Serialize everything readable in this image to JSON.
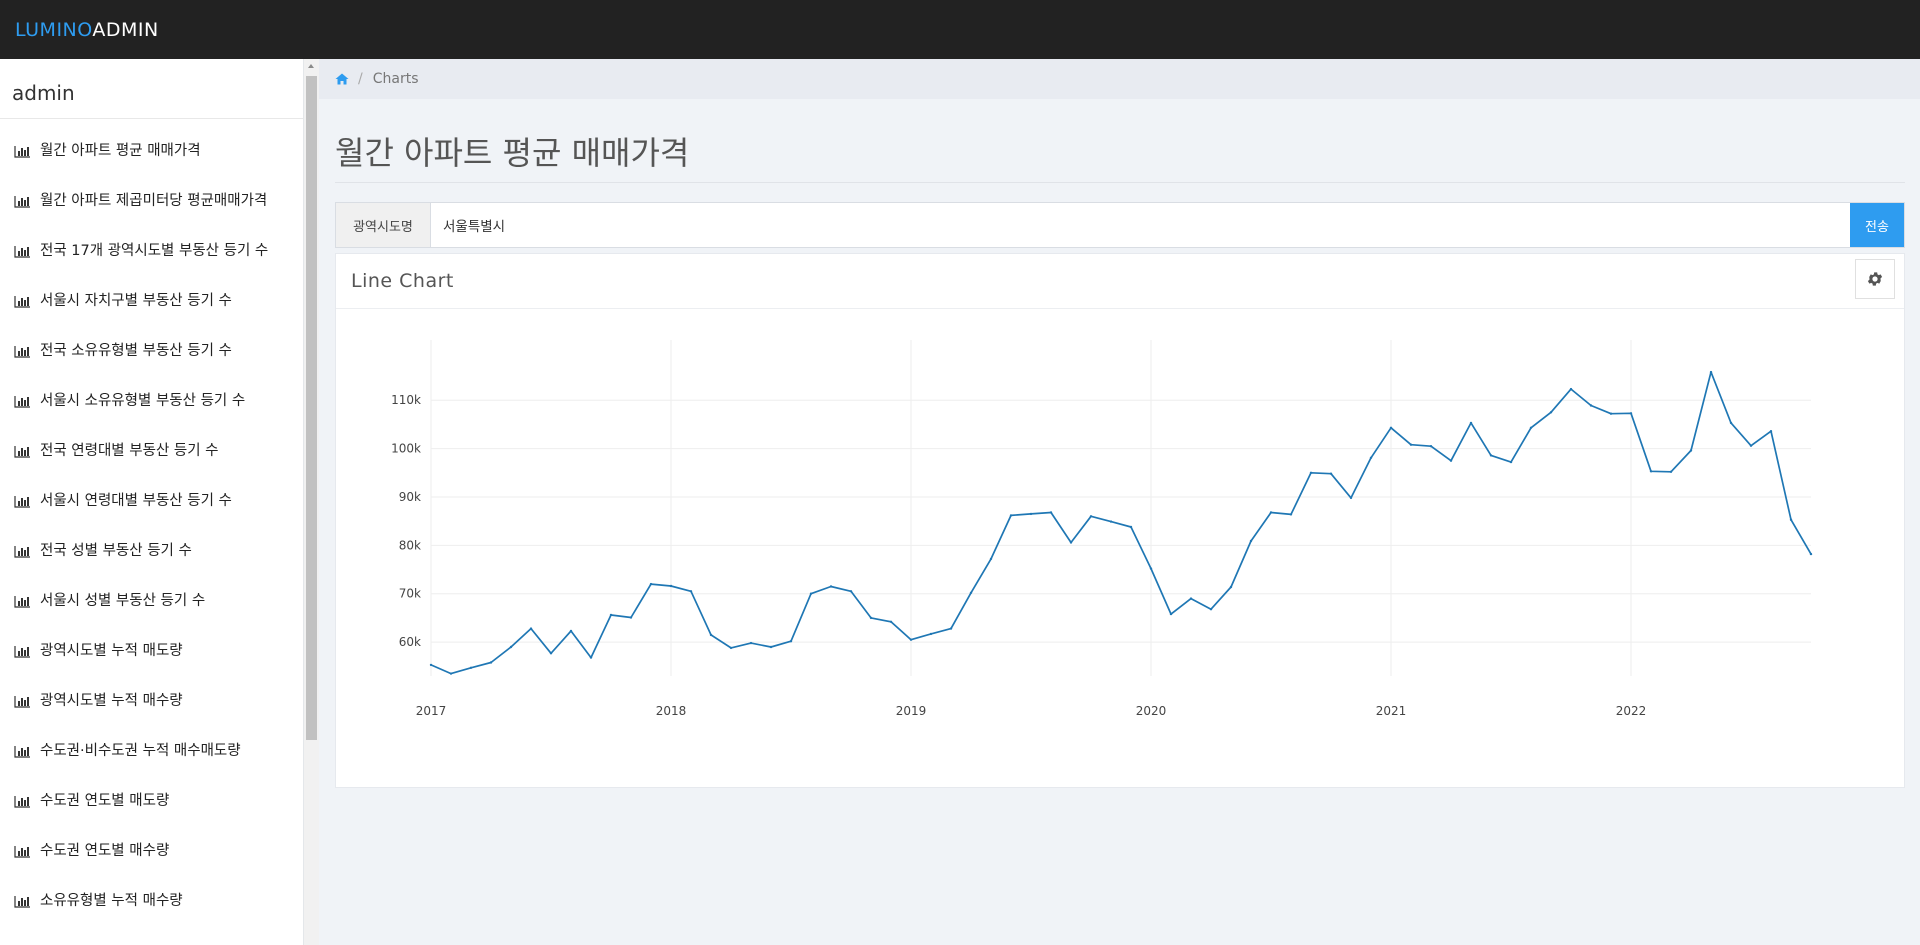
{
  "brand": {
    "part1": "LUMINO",
    "part2": "ADMIN"
  },
  "sidebar": {
    "user": "admin",
    "items": [
      {
        "label": "월간 아파트 평균 매매가격"
      },
      {
        "label": "월간 아파트 제곱미터당 평균매매가격"
      },
      {
        "label": "전국 17개 광역시도별 부동산 등기 수"
      },
      {
        "label": "서울시 자치구별 부동산 등기 수"
      },
      {
        "label": "전국 소유유형별 부동산 등기 수"
      },
      {
        "label": "서울시 소유유형별 부동산 등기 수"
      },
      {
        "label": "전국 연령대별 부동산 등기 수"
      },
      {
        "label": "서울시 연령대별 부동산 등기 수"
      },
      {
        "label": "전국 성별 부동산 등기 수"
      },
      {
        "label": "서울시 성별 부동산 등기 수"
      },
      {
        "label": "광역시도별 누적 매도량"
      },
      {
        "label": "광역시도별 누적 매수량"
      },
      {
        "label": "수도권·비수도권 누적 매수매도량"
      },
      {
        "label": "수도권 연도별 매도량"
      },
      {
        "label": "수도권 연도별 매수량"
      },
      {
        "label": "소유유형별 누적 매수량"
      }
    ]
  },
  "breadcrumb": {
    "current": "Charts",
    "separator": "/"
  },
  "page": {
    "title": "월간 아파트 평균 매매가격"
  },
  "search": {
    "label": "광역시도명",
    "value": "서울특별시",
    "button": "전송"
  },
  "panel": {
    "title": "Line Chart"
  },
  "colors": {
    "accent": "#2e9cf0",
    "line": "#1f77b4"
  },
  "chart_data": {
    "type": "line",
    "title": "",
    "xlabel": "",
    "ylabel": "",
    "xlim": [
      0,
      69
    ],
    "ylim": [
      53000,
      115000
    ],
    "x_ticks": [
      {
        "label": "2017",
        "x": 0
      },
      {
        "label": "2018",
        "x": 12
      },
      {
        "label": "2019",
        "x": 24
      },
      {
        "label": "2020",
        "x": 36
      },
      {
        "label": "2021",
        "x": 48
      },
      {
        "label": "2022",
        "x": 60
      }
    ],
    "y_ticks": [
      {
        "label": "60k",
        "y": 60000
      },
      {
        "label": "70k",
        "y": 70000
      },
      {
        "label": "80k",
        "y": 80000
      },
      {
        "label": "90k",
        "y": 90000
      },
      {
        "label": "100k",
        "y": 100000
      },
      {
        "label": "110k",
        "y": 110000
      }
    ],
    "grid": true,
    "series": [
      {
        "values": [
          55300,
          53500,
          54700,
          55800,
          59000,
          62800,
          57700,
          62300,
          56800,
          65600,
          65100,
          72000,
          71600,
          70500,
          61500,
          58800,
          59800,
          59000,
          60200,
          70000,
          71500,
          70500,
          65000,
          64200,
          60500,
          61700,
          62800,
          70200,
          77200,
          86200,
          86500,
          86800,
          80600,
          86000,
          84900,
          83800,
          75200,
          65800,
          69000,
          66800,
          71400,
          80900,
          86800,
          86400,
          95000,
          94800,
          89800,
          98100,
          104300,
          100800,
          100500,
          97500,
          105300,
          98600,
          97200,
          104300,
          107500,
          112300,
          108900,
          107200,
          107300,
          95300,
          95200,
          99600,
          115800,
          105300,
          100600,
          103600,
          85300,
          78200
        ]
      }
    ]
  }
}
